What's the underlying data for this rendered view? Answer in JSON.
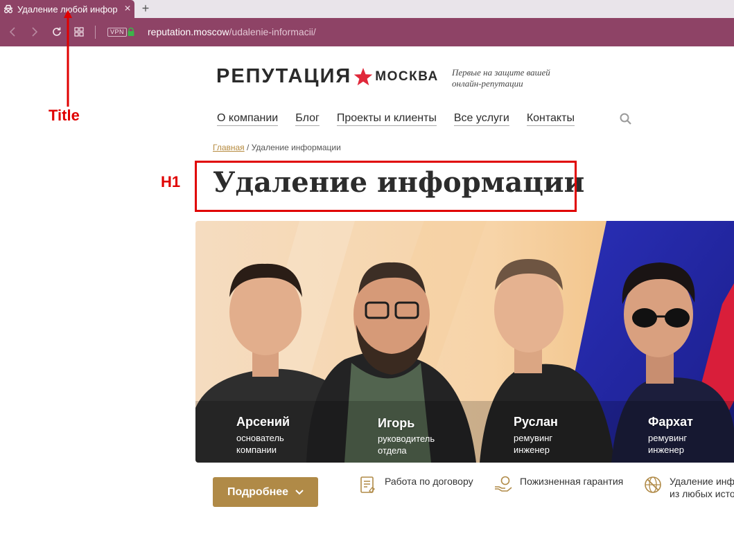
{
  "browser": {
    "tab_title": "Удаление любой информации",
    "new_tab": "+",
    "tab_close": "×",
    "vpn": "VPN",
    "url_host": "reputation.moscow",
    "url_path": "/udalenie-informacii/"
  },
  "annotations": {
    "title_label": "Title",
    "h1_label": "H1",
    "color": "#e00000"
  },
  "site": {
    "logo_main": "РЕПУТАЦИЯ",
    "logo_city": "МОСКВА",
    "tagline_line1": "Первые на защите вашей",
    "tagline_line2": "онлайн-репутации",
    "nav": [
      "О компании",
      "Блог",
      "Проекты и клиенты",
      "Все услуги",
      "Контакты"
    ],
    "breadcrumb_home": "Главная",
    "breadcrumb_sep": " / ",
    "breadcrumb_current": "Удаление информации",
    "h1": "Удаление информации"
  },
  "team": [
    {
      "name": "Арсений",
      "role_line1": "основатель",
      "role_line2": "компании"
    },
    {
      "name": "Игорь",
      "role_line1": "руководитель",
      "role_line2": "отдела"
    },
    {
      "name": "Руслан",
      "role_line1": "ремувинг",
      "role_line2": "инженер"
    },
    {
      "name": "Фархат",
      "role_line1": "ремувинг",
      "role_line2": "инженер"
    }
  ],
  "cta": {
    "more_label": "Подробнее"
  },
  "features": [
    {
      "icon": "contract-icon",
      "text": "Работа по договору"
    },
    {
      "icon": "guarantee-icon",
      "text": "Пожизненная гарантия"
    },
    {
      "icon": "globe-removal-icon",
      "line1": "Удаление информации",
      "line2": "из любых источников"
    }
  ],
  "colors": {
    "chrome": "#8e4366",
    "accent_gold": "#b08a47",
    "star_red": "#e0283a"
  }
}
